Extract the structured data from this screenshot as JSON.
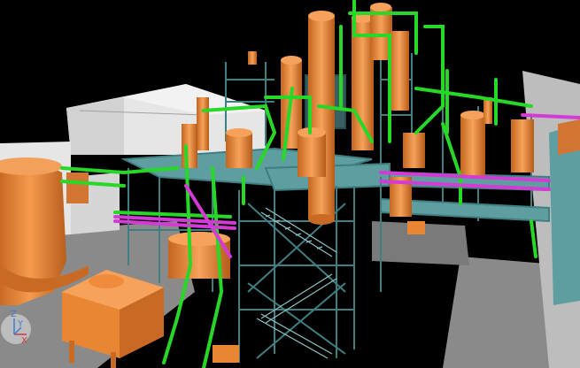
{
  "viewport": {
    "background": "#000000"
  },
  "palette": {
    "ground": "#000000",
    "building": "#e6e6e6",
    "building_shade": "#bdbdbd",
    "slab": "#8a8a8a",
    "equipment": "#f08a3c",
    "equipment_shade": "#c96a24",
    "steel": "#5f9ea0",
    "steel_dark": "#3f7f82",
    "pipe_green": "#27d827",
    "pipe_magenta": "#d43ad4"
  },
  "axis_triad": {
    "labels": {
      "z": "Z",
      "y": "Y",
      "x": "X"
    },
    "colors": {
      "z": "#3a7bd5",
      "y": "#3a7bd5",
      "x": "#d43a3a"
    }
  }
}
